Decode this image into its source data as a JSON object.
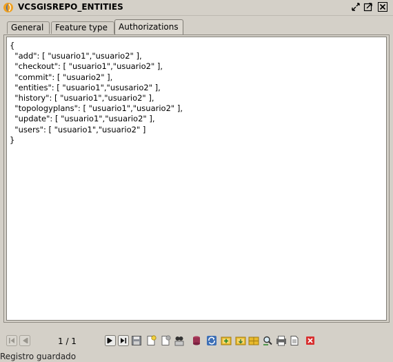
{
  "window": {
    "title": "VCSGISREPO_ENTITIES"
  },
  "tabs": [
    {
      "label": "General"
    },
    {
      "label": "Feature type"
    },
    {
      "label": "Authorizations"
    }
  ],
  "editor": {
    "content": "{\n  \"add\": [ \"usuario1\",\"usuario2\" ],\n  \"checkout\": [ \"usuario1\",\"usuario2\" ],\n  \"commit\": [ \"usuario2\" ],\n  \"entities\": [ \"usuario1\",\"ususario2\" ],\n  \"history\": [ \"usuario1\",\"usuario2\" ],\n  \"topologyplans\": [ \"usuario1\",\"usuario2\" ],\n  \"update\": [ \"usuario1\",\"usuario2\" ],\n  \"users\": [ \"usuario1\",\"usuario2\" ]\n}"
  },
  "navigation": {
    "page_counter": "1 / 1"
  },
  "status": {
    "message": "Registro guardado"
  },
  "colors": {
    "window_bg": "#d4d0c8",
    "editor_bg": "#ffffff",
    "delete_red": "#d83030",
    "db_blue": "#3d6fb6",
    "folder_yellow": "#e8b92c"
  }
}
